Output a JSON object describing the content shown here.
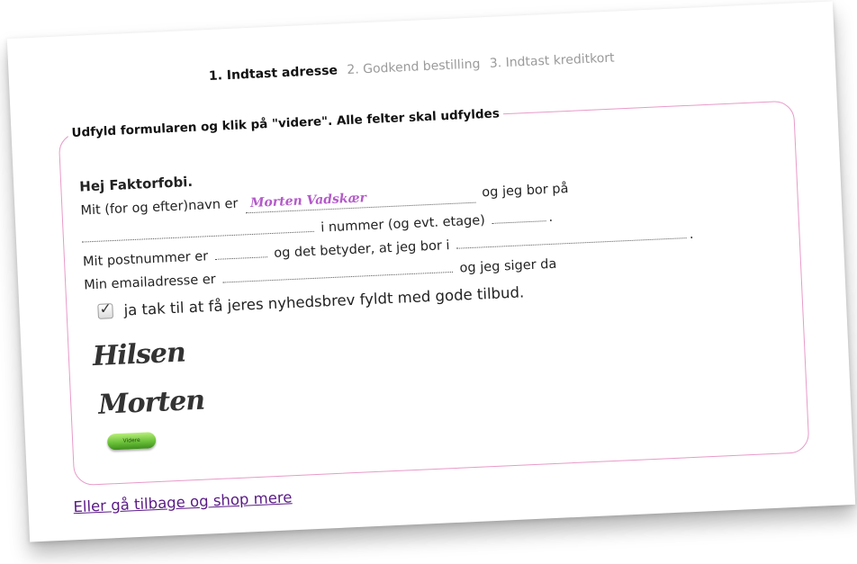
{
  "steps": {
    "step1": "1. Indtast adresse",
    "step2": "2. Godkend bestilling",
    "step3": "3. Indtast kreditkort"
  },
  "form": {
    "legend": "Udfyld formularen og klik på \"videre\". Alle felter skal udfyldes",
    "greeting": "Hej Faktorfobi.",
    "name_prefix": "Mit (for og efter)navn er",
    "name_value": "Morten Vadskær",
    "name_suffix": "og jeg bor på",
    "number_text": "i nummer (og evt. etage)",
    "period": ".",
    "postcode_prefix": "Mit postnummer er",
    "postcode_middle": "og det betyder, at jeg bor i",
    "email_prefix": "Min emailadresse er",
    "email_suffix": "og jeg siger da",
    "newsletter_label": "ja tak til at få jeres nyhedsbrev fyldt med gode tilbud.",
    "newsletter_checked": true,
    "closing": "Hilsen",
    "signature": "Morten",
    "submit_label": "Videre"
  },
  "back_link": "Eller gå tilbage og shop mere",
  "colors": {
    "border": "#e89ac8",
    "name_value": "#b45ac9",
    "link": "#5a1a86",
    "button": "#6cc23a"
  }
}
